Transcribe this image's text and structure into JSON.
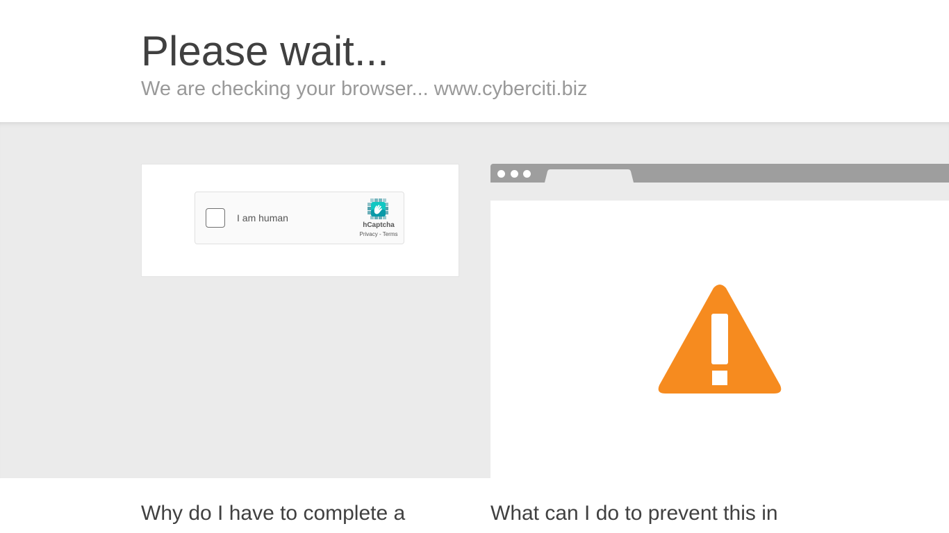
{
  "header": {
    "title": "Please wait...",
    "subtitle": "We are checking your browser... www.cyberciti.biz"
  },
  "captcha": {
    "label": "I am human",
    "brand": "hCaptcha",
    "privacy_link": "Privacy",
    "separator": " - ",
    "terms_link": "Terms"
  },
  "illustration": {
    "icon": "warning-icon",
    "icon_color": "#f68b1f"
  },
  "faq": {
    "why_heading": "Why do I have to complete a",
    "prevent_heading": "What can I do to prevent this in"
  },
  "colors": {
    "band": "#ebebeb",
    "browser_bar": "#9e9e9e",
    "title_text": "#404040",
    "subtitle_text": "#999999"
  }
}
